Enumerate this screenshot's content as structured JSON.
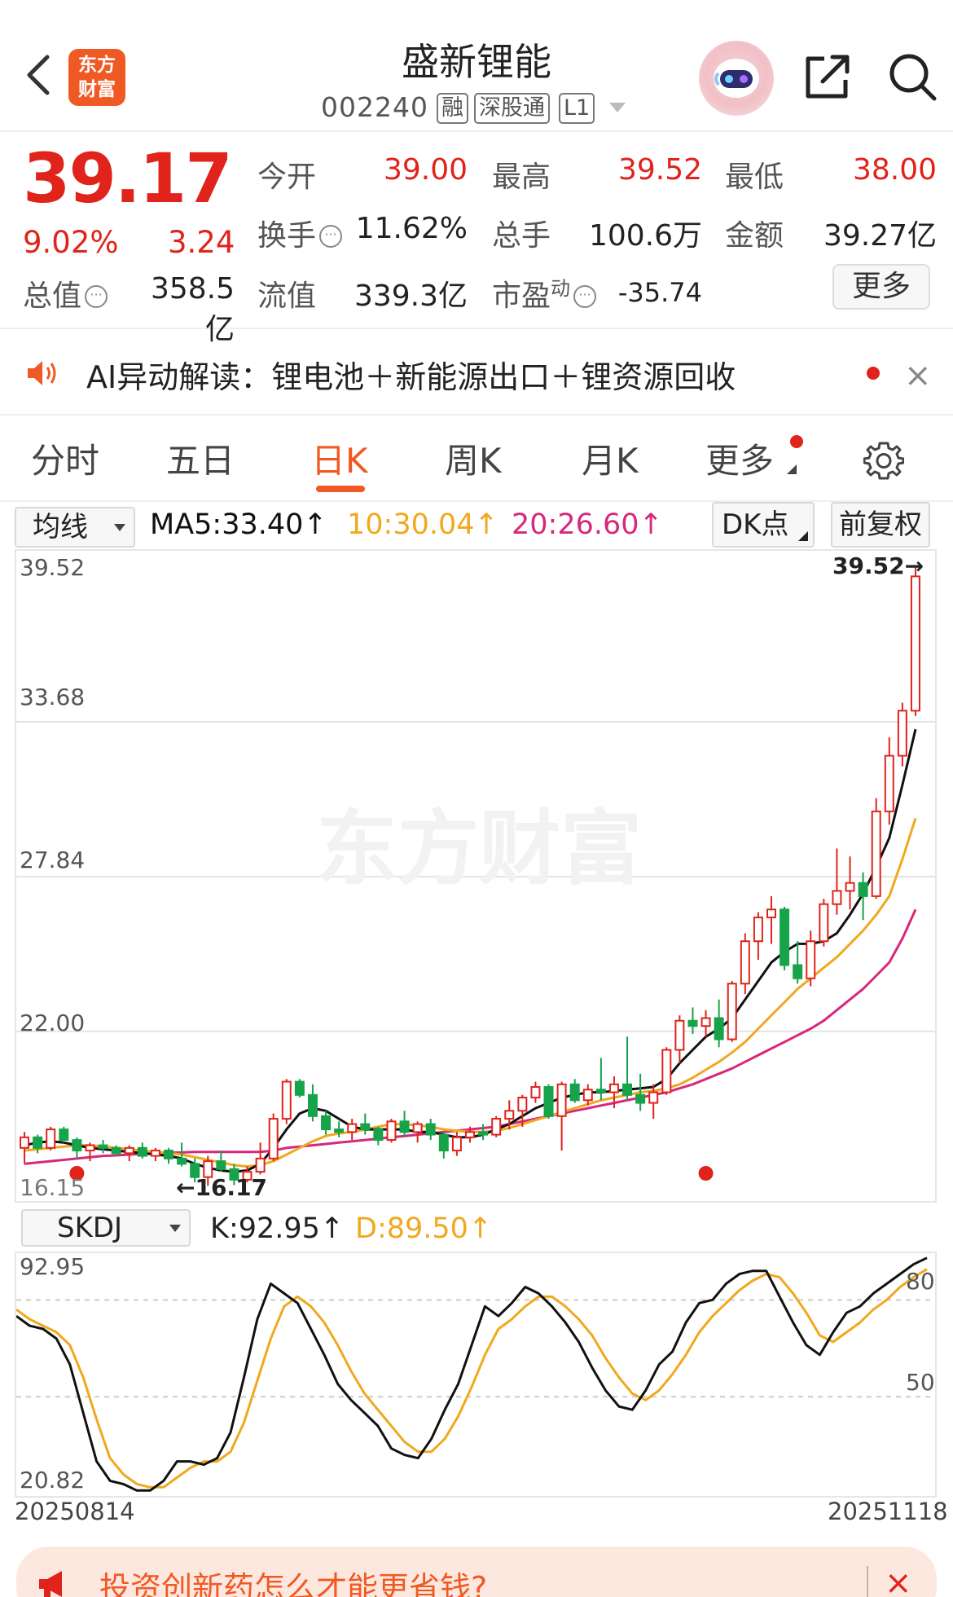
{
  "header": {
    "logo_line1": "东方",
    "logo_line2": "财富",
    "stock_name": "盛新锂能",
    "stock_code": "002240",
    "tags": [
      "融",
      "深股通",
      "L1"
    ]
  },
  "quote": {
    "last_price": "39.17",
    "pct_change": "9.02%",
    "abs_change": "3.24",
    "fields": {
      "open_label": "今开",
      "open_value": "39.00",
      "high_label": "最高",
      "high_value": "39.52",
      "low_label": "最低",
      "low_value": "38.00",
      "turnover_label": "换手",
      "turnover_value": "11.62%",
      "volume_label": "总手",
      "volume_value": "100.6万",
      "amount_label": "金额",
      "amount_value": "39.27亿",
      "mktcap_label": "总值",
      "mktcap_value": "358.5亿",
      "float_label": "流值",
      "float_value": "339.3亿",
      "pe_label": "市盈",
      "pe_sup": "动",
      "pe_value": "-35.74"
    },
    "more_button": "更多"
  },
  "ai_bar": {
    "text": "AI异动解读：锂电池＋新能源出口＋锂资源回收",
    "close": "×"
  },
  "tabs": {
    "items": [
      "分时",
      "五日",
      "日K",
      "周K",
      "月K",
      "更多"
    ],
    "active": "日K"
  },
  "indicator_bar": {
    "ma_selector": "均线",
    "ma5": "MA5:33.40↑",
    "ma10": "10:30.04↑",
    "ma20": "20:26.60↑",
    "dk_button": "DK点",
    "adjust_button": "前复权"
  },
  "colors": {
    "up": "#e0231b",
    "down": "#16a34a",
    "ma5": "#111111",
    "ma10": "#f0a91e",
    "ma20": "#d6287c",
    "brand": "#ef5a24"
  },
  "chart_data": [
    {
      "type": "candlestick",
      "ylim": [
        16.15,
        39.52
      ],
      "y_ticks": [
        "39.52",
        "33.68",
        "27.84",
        "22.00",
        "16.15"
      ],
      "high_annotation": "39.52→",
      "low_annotation": "←16.17",
      "watermark": "东方财富",
      "x_range": [
        "20250814",
        "20251118"
      ],
      "candles": [
        [
          17.6,
          18.2,
          17.0,
          18.0
        ],
        [
          18.0,
          18.1,
          17.4,
          17.6
        ],
        [
          17.6,
          18.4,
          17.5,
          18.3
        ],
        [
          18.3,
          18.4,
          17.8,
          17.9
        ],
        [
          17.9,
          18.0,
          17.2,
          17.5
        ],
        [
          17.5,
          17.8,
          17.1,
          17.7
        ],
        [
          17.7,
          17.9,
          17.4,
          17.6
        ],
        [
          17.6,
          17.7,
          17.3,
          17.4
        ],
        [
          17.4,
          17.7,
          17.1,
          17.6
        ],
        [
          17.6,
          17.8,
          17.2,
          17.3
        ],
        [
          17.3,
          17.6,
          17.1,
          17.5
        ],
        [
          17.5,
          17.6,
          17.0,
          17.2
        ],
        [
          17.2,
          17.8,
          16.9,
          17.0
        ],
        [
          17.0,
          17.2,
          16.3,
          16.5
        ],
        [
          16.5,
          17.3,
          16.17,
          17.1
        ],
        [
          17.1,
          17.5,
          16.7,
          16.8
        ],
        [
          16.8,
          17.0,
          16.2,
          16.4
        ],
        [
          16.4,
          16.9,
          16.3,
          16.7
        ],
        [
          16.7,
          17.8,
          16.6,
          17.2
        ],
        [
          17.2,
          18.9,
          17.1,
          18.7
        ],
        [
          18.7,
          20.2,
          18.5,
          20.1
        ],
        [
          20.1,
          20.2,
          19.5,
          19.6
        ],
        [
          19.6,
          20.0,
          18.6,
          18.8
        ],
        [
          18.8,
          19.0,
          18.1,
          18.3
        ],
        [
          18.3,
          18.6,
          18.0,
          18.2
        ],
        [
          18.2,
          18.7,
          17.9,
          18.5
        ],
        [
          18.5,
          18.9,
          18.1,
          18.3
        ],
        [
          18.3,
          18.4,
          17.7,
          17.9
        ],
        [
          17.9,
          18.7,
          17.8,
          18.6
        ],
        [
          18.6,
          19.0,
          18.0,
          18.2
        ],
        [
          18.2,
          18.6,
          17.8,
          18.5
        ],
        [
          18.5,
          18.7,
          17.9,
          18.1
        ],
        [
          18.1,
          18.2,
          17.2,
          17.5
        ],
        [
          17.5,
          18.2,
          17.3,
          18.0
        ],
        [
          18.0,
          18.4,
          17.8,
          18.2
        ],
        [
          18.2,
          18.5,
          17.9,
          18.1
        ],
        [
          18.1,
          18.8,
          18.0,
          18.7
        ],
        [
          18.7,
          19.4,
          18.3,
          19.0
        ],
        [
          19.0,
          19.6,
          18.4,
          19.5
        ],
        [
          19.5,
          20.1,
          19.3,
          19.9
        ],
        [
          19.9,
          20.0,
          18.7,
          18.8
        ],
        [
          18.8,
          20.1,
          17.5,
          20.0
        ],
        [
          20.0,
          20.2,
          19.3,
          19.4
        ],
        [
          19.4,
          20.0,
          19.2,
          19.8
        ],
        [
          19.8,
          21.0,
          19.4,
          19.7
        ],
        [
          19.7,
          20.3,
          19.1,
          20.0
        ],
        [
          20.0,
          21.8,
          19.4,
          19.6
        ],
        [
          19.6,
          20.4,
          19.0,
          19.3
        ],
        [
          19.3,
          20.0,
          18.7,
          19.7
        ],
        [
          19.7,
          21.4,
          19.6,
          21.3
        ],
        [
          21.3,
          22.6,
          20.8,
          22.4
        ],
        [
          22.4,
          22.9,
          21.9,
          22.2
        ],
        [
          22.2,
          22.8,
          21.8,
          22.5
        ],
        [
          22.5,
          23.2,
          21.4,
          21.7
        ],
        [
          21.7,
          23.9,
          21.6,
          23.8
        ],
        [
          23.8,
          25.7,
          23.4,
          25.4
        ],
        [
          25.4,
          26.5,
          24.7,
          26.3
        ],
        [
          26.3,
          27.1,
          25.3,
          26.6
        ],
        [
          26.6,
          26.7,
          24.3,
          24.5
        ],
        [
          24.5,
          25.4,
          23.8,
          24.0
        ],
        [
          24.0,
          25.8,
          23.7,
          25.4
        ],
        [
          25.4,
          27.0,
          25.2,
          26.8
        ],
        [
          26.8,
          28.9,
          26.4,
          27.3
        ],
        [
          27.3,
          28.6,
          26.6,
          27.6
        ],
        [
          27.6,
          28.0,
          26.2,
          27.1
        ],
        [
          27.1,
          30.8,
          27.0,
          30.3
        ],
        [
          30.3,
          33.1,
          29.8,
          32.4
        ],
        [
          32.4,
          34.4,
          32.0,
          34.1
        ],
        [
          34.1,
          39.52,
          33.9,
          39.17
        ]
      ],
      "signals": [
        4,
        52
      ],
      "series": [
        {
          "name": "MA5",
          "values": [
            17.7,
            17.8,
            17.85,
            17.8,
            17.7,
            17.6,
            17.55,
            17.5,
            17.45,
            17.4,
            17.35,
            17.3,
            17.2,
            17.0,
            16.85,
            16.75,
            16.7,
            16.75,
            17.0,
            17.6,
            18.3,
            18.9,
            19.1,
            19.0,
            18.7,
            18.4,
            18.3,
            18.3,
            18.3,
            18.3,
            18.2,
            18.2,
            18.1,
            18.0,
            18.0,
            18.1,
            18.3,
            18.5,
            18.8,
            19.1,
            19.3,
            19.5,
            19.6,
            19.7,
            19.7,
            19.75,
            19.8,
            19.85,
            19.9,
            20.2,
            20.8,
            21.3,
            21.8,
            22.1,
            22.5,
            23.2,
            23.9,
            24.6,
            25.0,
            25.3,
            25.3,
            25.4,
            25.7,
            26.4,
            27.2,
            28.2,
            29.3,
            31.3,
            33.4
          ]
        },
        {
          "name": "10",
          "values": [
            17.5,
            17.55,
            17.6,
            17.65,
            17.7,
            17.7,
            17.65,
            17.6,
            17.55,
            17.5,
            17.45,
            17.4,
            17.35,
            17.25,
            17.15,
            17.05,
            16.95,
            16.9,
            16.95,
            17.1,
            17.35,
            17.6,
            17.85,
            18.05,
            18.15,
            18.2,
            18.3,
            18.4,
            18.5,
            18.5,
            18.45,
            18.4,
            18.3,
            18.25,
            18.2,
            18.2,
            18.25,
            18.35,
            18.5,
            18.65,
            18.8,
            18.95,
            19.1,
            19.25,
            19.4,
            19.5,
            19.6,
            19.7,
            19.75,
            19.85,
            20.0,
            20.25,
            20.55,
            20.85,
            21.2,
            21.6,
            22.1,
            22.6,
            23.1,
            23.6,
            24.0,
            24.4,
            24.8,
            25.3,
            25.8,
            26.4,
            27.1,
            28.5,
            30.04
          ]
        },
        {
          "name": "20",
          "values": [
            17.0,
            17.05,
            17.1,
            17.15,
            17.2,
            17.25,
            17.3,
            17.32,
            17.35,
            17.37,
            17.4,
            17.42,
            17.43,
            17.45,
            17.45,
            17.45,
            17.45,
            17.45,
            17.45,
            17.5,
            17.6,
            17.65,
            17.7,
            17.75,
            17.8,
            17.85,
            17.9,
            17.95,
            18.0,
            18.05,
            18.1,
            18.15,
            18.2,
            18.25,
            18.3,
            18.35,
            18.4,
            18.5,
            18.6,
            18.7,
            18.8,
            18.9,
            19.0,
            19.1,
            19.2,
            19.3,
            19.4,
            19.5,
            19.6,
            19.7,
            19.85,
            20.0,
            20.2,
            20.4,
            20.6,
            20.85,
            21.1,
            21.35,
            21.6,
            21.85,
            22.1,
            22.4,
            22.8,
            23.2,
            23.6,
            24.1,
            24.6,
            25.5,
            26.6
          ]
        }
      ]
    },
    {
      "type": "line",
      "title": "SKDJ",
      "k_label": "K:92.95↑",
      "d_label": "D:89.50↑",
      "ylim": [
        20.82,
        92.95
      ],
      "y_ticks": [
        "92.95",
        "20.82"
      ],
      "ref_lines": [
        80,
        50
      ],
      "series": [
        {
          "name": "K",
          "values": [
            75,
            72,
            71,
            68,
            60,
            45,
            30,
            24,
            23,
            21,
            21,
            24,
            30,
            30,
            29,
            31,
            39,
            56,
            74,
            85,
            82,
            79,
            71,
            63,
            54,
            49,
            45,
            41,
            34,
            32,
            31,
            37,
            46,
            54,
            66,
            78,
            75,
            79,
            84,
            82,
            78,
            73,
            67,
            59,
            52,
            47,
            46,
            52,
            60,
            64,
            73,
            79,
            80,
            85,
            88,
            89,
            89,
            81,
            73,
            66,
            63,
            70,
            76,
            78,
            82,
            85,
            88,
            91,
            93
          ]
        },
        {
          "name": "D",
          "values": [
            77,
            74,
            72,
            70,
            66,
            56,
            43,
            31,
            26,
            23,
            22,
            22,
            25,
            28,
            30,
            30,
            33,
            42,
            55,
            68,
            78,
            81,
            78,
            73,
            66,
            58,
            51,
            46,
            41,
            36,
            33,
            33,
            37,
            44,
            53,
            63,
            71,
            74,
            78,
            81,
            81,
            78,
            74,
            69,
            62,
            56,
            51,
            49,
            52,
            57,
            63,
            70,
            75,
            79,
            83,
            86,
            88,
            87,
            82,
            76,
            69,
            67,
            70,
            73,
            77,
            80,
            84,
            87,
            89.5
          ]
        }
      ]
    }
  ],
  "chart_labels": {
    "high_annotation": "39.52→",
    "low_annotation": "←16.17",
    "watermark": "东方财富",
    "k_y_ticks": [
      "39.52",
      "33.68",
      "27.84",
      "22.00",
      "16.15"
    ],
    "skdj_selector": "SKDJ",
    "skdj_k": "K:92.95↑",
    "skdj_d": "D:89.50↑",
    "skdj_top": "92.95",
    "skdj_bottom": "20.82",
    "skdj_80": "80",
    "skdj_50": "50",
    "start_date": "20250814",
    "end_date": "20251118"
  },
  "ad": {
    "text": "投资创新药怎么才能更省钱?",
    "close": "×"
  }
}
